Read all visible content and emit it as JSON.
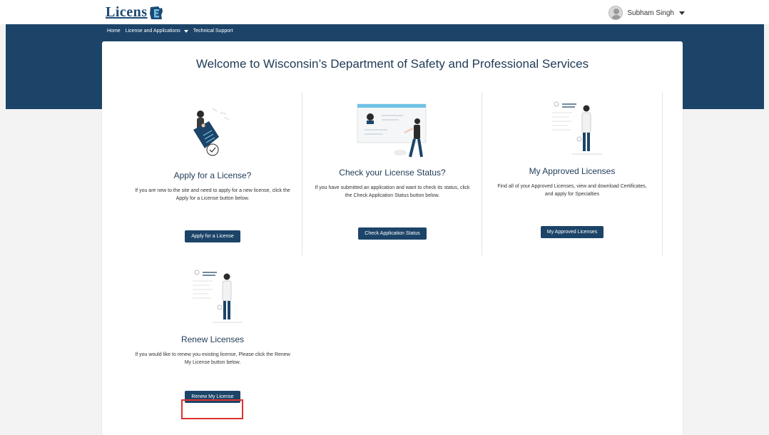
{
  "header": {
    "logo_text": "Licens",
    "user_name": "Subham Singh"
  },
  "nav": {
    "home": "Home",
    "licenses": "License and Applications",
    "support": "Technical Support"
  },
  "main": {
    "welcome_title": "Welcome to Wisconsin’s Department of Safety and Professional Services",
    "tiles": [
      {
        "title": "Apply for a License?",
        "description": "If you are new to the site and need to apply for a new license, click the Apply for a License button below.",
        "button": "Apply for a License"
      },
      {
        "title": "Check your License Status?",
        "description": "If you have submitted an application and want to check its status, click the Check Application Status button below.",
        "button": "Check Application Status"
      },
      {
        "title": "My Approved Licenses",
        "description": "Find all of your Approved Licenses, view and download Certificates, and apply for Specialties",
        "button": "My Approved Licenses"
      },
      {
        "title": "Renew Licenses",
        "description": "If you would like to renew you existing license, Please click the Renew My License button below.",
        "button": "Renew My License"
      }
    ]
  },
  "colors": {
    "brand_navy": "#1c4468",
    "highlight_red": "#e0312e"
  }
}
